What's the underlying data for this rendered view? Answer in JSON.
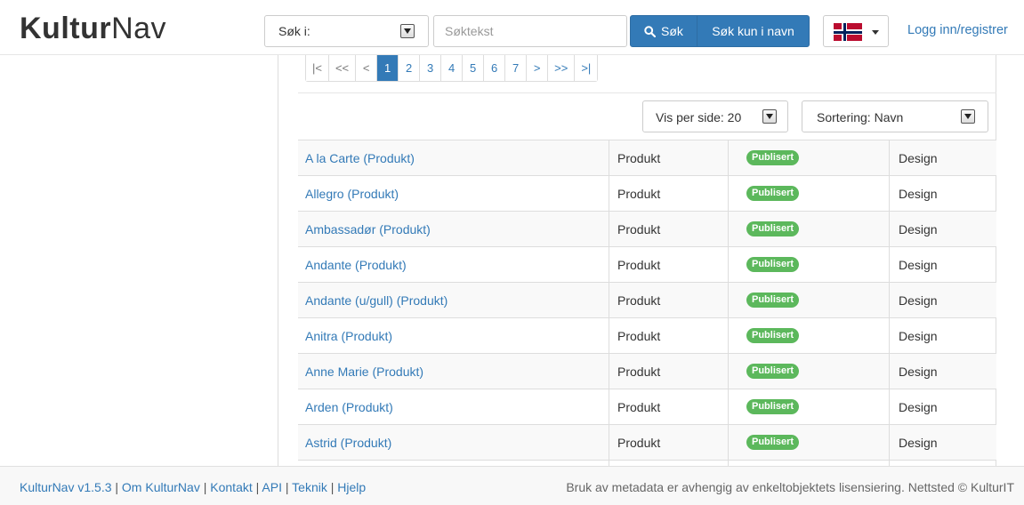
{
  "header": {
    "logo_bold": "Kultur",
    "logo_light": "Nav",
    "search_in_label": "Søk i:",
    "search_placeholder": "Søktekst",
    "search_button": "Søk",
    "search_name_button": "Søk kun i navn",
    "language_flag": "norway-flag-icon",
    "login_link": "Logg inn/registrer"
  },
  "pagination": {
    "first": "|<",
    "prev_many": "<<",
    "prev": "<",
    "pages": [
      "1",
      "2",
      "3",
      "4",
      "5",
      "6",
      "7"
    ],
    "active_page": "1",
    "next": ">",
    "next_many": ">>",
    "last": ">|"
  },
  "controls": {
    "per_page": "Vis per side: 20",
    "sorting": "Sortering: Navn"
  },
  "table": {
    "rows": [
      {
        "name": "A la Carte (Produkt)",
        "type": "Produkt",
        "status": "Publisert",
        "dataset": "Design"
      },
      {
        "name": "Allegro (Produkt)",
        "type": "Produkt",
        "status": "Publisert",
        "dataset": "Design"
      },
      {
        "name": "Ambassadør (Produkt)",
        "type": "Produkt",
        "status": "Publisert",
        "dataset": "Design"
      },
      {
        "name": "Andante (Produkt)",
        "type": "Produkt",
        "status": "Publisert",
        "dataset": "Design"
      },
      {
        "name": "Andante (u/gull) (Produkt)",
        "type": "Produkt",
        "status": "Publisert",
        "dataset": "Design"
      },
      {
        "name": "Anitra (Produkt)",
        "type": "Produkt",
        "status": "Publisert",
        "dataset": "Design"
      },
      {
        "name": "Anne Marie (Produkt)",
        "type": "Produkt",
        "status": "Publisert",
        "dataset": "Design"
      },
      {
        "name": "Arden (Produkt)",
        "type": "Produkt",
        "status": "Publisert",
        "dataset": "Design"
      },
      {
        "name": "Astrid (Produkt)",
        "type": "Produkt",
        "status": "Publisert",
        "dataset": "Design"
      }
    ]
  },
  "footer": {
    "links": [
      "KulturNav v1.5.3",
      "Om KulturNav",
      "Kontakt",
      "API",
      "Teknik",
      "Hjelp"
    ],
    "separator": "|",
    "right_text": "Bruk av metadata er avhengig av enkeltobjektets lisensiering. Nettsted © KulturIT"
  },
  "colors": {
    "primary": "#337ab7",
    "status_published": "#5cb85c"
  }
}
